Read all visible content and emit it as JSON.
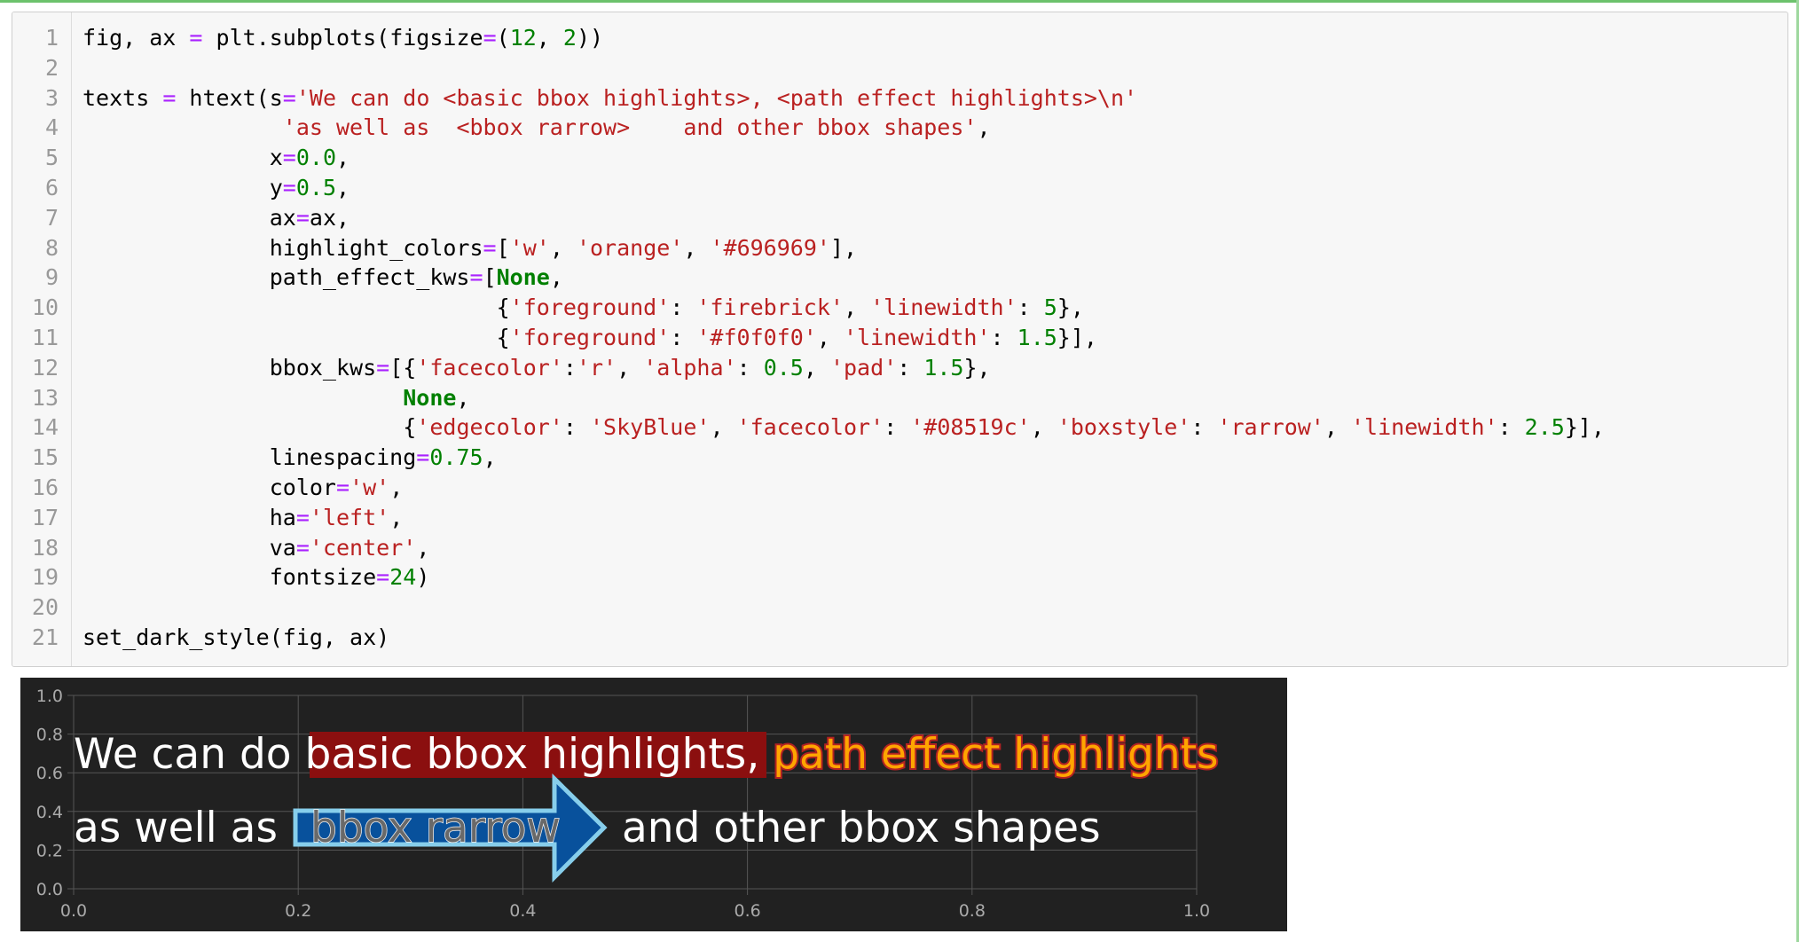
{
  "code_cell": {
    "lines": [
      [
        {
          "t": "fig, ax ",
          "c": ""
        },
        {
          "t": "=",
          "c": "op"
        },
        {
          "t": " plt.subplots(figsize",
          "c": ""
        },
        {
          "t": "=",
          "c": "op"
        },
        {
          "t": "(",
          "c": ""
        },
        {
          "t": "12",
          "c": "nu"
        },
        {
          "t": ", ",
          "c": ""
        },
        {
          "t": "2",
          "c": "nu"
        },
        {
          "t": "))",
          "c": ""
        }
      ],
      [],
      [
        {
          "t": "texts ",
          "c": ""
        },
        {
          "t": "=",
          "c": "op"
        },
        {
          "t": " htext(s",
          "c": ""
        },
        {
          "t": "=",
          "c": "op"
        },
        {
          "t": "'We can do <basic bbox highlights>, <path effect highlights>\\n'",
          "c": "st"
        }
      ],
      [
        {
          "t": "               ",
          "c": ""
        },
        {
          "t": "'as well as  <bbox rarrow>    and other bbox shapes'",
          "c": "st"
        },
        {
          "t": ",",
          "c": ""
        }
      ],
      [
        {
          "t": "              x",
          "c": ""
        },
        {
          "t": "=",
          "c": "op"
        },
        {
          "t": "0.0",
          "c": "nu"
        },
        {
          "t": ",",
          "c": ""
        }
      ],
      [
        {
          "t": "              y",
          "c": ""
        },
        {
          "t": "=",
          "c": "op"
        },
        {
          "t": "0.5",
          "c": "nu"
        },
        {
          "t": ",",
          "c": ""
        }
      ],
      [
        {
          "t": "              ax",
          "c": ""
        },
        {
          "t": "=",
          "c": "op"
        },
        {
          "t": "ax,",
          "c": ""
        }
      ],
      [
        {
          "t": "              highlight_colors",
          "c": ""
        },
        {
          "t": "=",
          "c": "op"
        },
        {
          "t": "[",
          "c": ""
        },
        {
          "t": "'w'",
          "c": "st"
        },
        {
          "t": ", ",
          "c": ""
        },
        {
          "t": "'orange'",
          "c": "st"
        },
        {
          "t": ", ",
          "c": ""
        },
        {
          "t": "'#696969'",
          "c": "st"
        },
        {
          "t": "],",
          "c": ""
        }
      ],
      [
        {
          "t": "              path_effect_kws",
          "c": ""
        },
        {
          "t": "=",
          "c": "op"
        },
        {
          "t": "[",
          "c": ""
        },
        {
          "t": "None",
          "c": "kw"
        },
        {
          "t": ",",
          "c": ""
        }
      ],
      [
        {
          "t": "                               {",
          "c": ""
        },
        {
          "t": "'foreground'",
          "c": "st"
        },
        {
          "t": ": ",
          "c": ""
        },
        {
          "t": "'firebrick'",
          "c": "st"
        },
        {
          "t": ", ",
          "c": ""
        },
        {
          "t": "'linewidth'",
          "c": "st"
        },
        {
          "t": ": ",
          "c": ""
        },
        {
          "t": "5",
          "c": "nu"
        },
        {
          "t": "},",
          "c": ""
        }
      ],
      [
        {
          "t": "                               {",
          "c": ""
        },
        {
          "t": "'foreground'",
          "c": "st"
        },
        {
          "t": ": ",
          "c": ""
        },
        {
          "t": "'#f0f0f0'",
          "c": "st"
        },
        {
          "t": ", ",
          "c": ""
        },
        {
          "t": "'linewidth'",
          "c": "st"
        },
        {
          "t": ": ",
          "c": ""
        },
        {
          "t": "1.5",
          "c": "nu"
        },
        {
          "t": "}],",
          "c": ""
        }
      ],
      [
        {
          "t": "              bbox_kws",
          "c": ""
        },
        {
          "t": "=",
          "c": "op"
        },
        {
          "t": "[{",
          "c": ""
        },
        {
          "t": "'facecolor'",
          "c": "st"
        },
        {
          "t": ":",
          "c": ""
        },
        {
          "t": "'r'",
          "c": "st"
        },
        {
          "t": ", ",
          "c": ""
        },
        {
          "t": "'alpha'",
          "c": "st"
        },
        {
          "t": ": ",
          "c": ""
        },
        {
          "t": "0.5",
          "c": "nu"
        },
        {
          "t": ", ",
          "c": ""
        },
        {
          "t": "'pad'",
          "c": "st"
        },
        {
          "t": ": ",
          "c": ""
        },
        {
          "t": "1.5",
          "c": "nu"
        },
        {
          "t": "},",
          "c": ""
        }
      ],
      [
        {
          "t": "                        ",
          "c": ""
        },
        {
          "t": "None",
          "c": "kw"
        },
        {
          "t": ",",
          "c": ""
        }
      ],
      [
        {
          "t": "                        {",
          "c": ""
        },
        {
          "t": "'edgecolor'",
          "c": "st"
        },
        {
          "t": ": ",
          "c": ""
        },
        {
          "t": "'SkyBlue'",
          "c": "st"
        },
        {
          "t": ", ",
          "c": ""
        },
        {
          "t": "'facecolor'",
          "c": "st"
        },
        {
          "t": ": ",
          "c": ""
        },
        {
          "t": "'#08519c'",
          "c": "st"
        },
        {
          "t": ", ",
          "c": ""
        },
        {
          "t": "'boxstyle'",
          "c": "st"
        },
        {
          "t": ": ",
          "c": ""
        },
        {
          "t": "'rarrow'",
          "c": "st"
        },
        {
          "t": ", ",
          "c": ""
        },
        {
          "t": "'linewidth'",
          "c": "st"
        },
        {
          "t": ": ",
          "c": ""
        },
        {
          "t": "2.5",
          "c": "nu"
        },
        {
          "t": "}],",
          "c": ""
        }
      ],
      [
        {
          "t": "              linespacing",
          "c": ""
        },
        {
          "t": "=",
          "c": "op"
        },
        {
          "t": "0.75",
          "c": "nu"
        },
        {
          "t": ",",
          "c": ""
        }
      ],
      [
        {
          "t": "              color",
          "c": ""
        },
        {
          "t": "=",
          "c": "op"
        },
        {
          "t": "'w'",
          "c": "st"
        },
        {
          "t": ",",
          "c": ""
        }
      ],
      [
        {
          "t": "              ha",
          "c": ""
        },
        {
          "t": "=",
          "c": "op"
        },
        {
          "t": "'left'",
          "c": "st"
        },
        {
          "t": ",",
          "c": ""
        }
      ],
      [
        {
          "t": "              va",
          "c": ""
        },
        {
          "t": "=",
          "c": "op"
        },
        {
          "t": "'center'",
          "c": "st"
        },
        {
          "t": ",",
          "c": ""
        }
      ],
      [
        {
          "t": "              fontsize",
          "c": ""
        },
        {
          "t": "=",
          "c": "op"
        },
        {
          "t": "24",
          "c": "nu"
        },
        {
          "t": ")",
          "c": ""
        }
      ],
      [],
      [
        {
          "t": "set_dark_style(fig, ax)",
          "c": ""
        }
      ]
    ]
  },
  "output": {
    "line1": {
      "plain_prefix": "We can do ",
      "bbox_highlight": "basic bbox highlights",
      "separator": ", ",
      "path_effect_highlight": "path effect highlights"
    },
    "line2": {
      "plain_prefix": "as well as ",
      "arrow_text": "bbox rarrow",
      "plain_suffix": "and other bbox shapes"
    }
  },
  "colors": {
    "background": "#212121",
    "text": "#ffffff",
    "bbox_face": "#8b0f0f",
    "path_text": "#ffa500",
    "path_outline": "#b22222",
    "arrow_face": "#08519c",
    "arrow_edge": "#87ceeb",
    "arrow_text": "#696969",
    "grid": "#555555",
    "tick_label": "#aaaaaa"
  },
  "chart_data": {
    "type": "text",
    "x_ticks": [
      "0.0",
      "0.2",
      "0.4",
      "0.6",
      "0.8",
      "1.0"
    ],
    "y_ticks": [
      "0.0",
      "0.2",
      "0.4",
      "0.6",
      "0.8",
      "1.0"
    ],
    "xlim": [
      0,
      1
    ],
    "ylim": [
      0,
      1
    ],
    "grid": true
  }
}
